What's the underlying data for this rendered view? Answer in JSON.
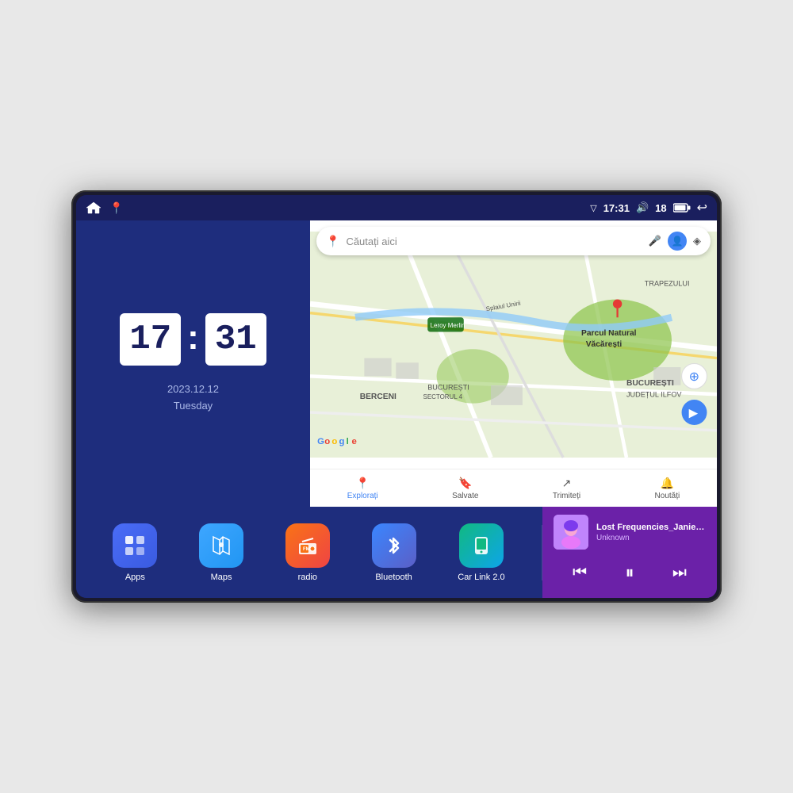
{
  "device": {
    "statusBar": {
      "time": "17:31",
      "signal": "18",
      "backLabel": "←"
    },
    "clock": {
      "hours": "17",
      "minutes": "31",
      "date": "2023.12.12",
      "day": "Tuesday"
    },
    "map": {
      "searchPlaceholder": "Căutați aici",
      "tabs": [
        {
          "label": "Explorați",
          "active": true
        },
        {
          "label": "Salvate",
          "active": false
        },
        {
          "label": "Trimiteți",
          "active": false
        },
        {
          "label": "Noutăți",
          "active": false
        }
      ],
      "markers": [
        "Parcul Natural Văcărești",
        "Leroy Merlin",
        "BUCUREȘTI",
        "JUDEȚUL ILFOV",
        "BERCENI",
        "TRAPEZULUI",
        "BUCUREȘTI SECTORUL 4"
      ]
    },
    "apps": [
      {
        "id": "apps",
        "label": "Apps",
        "icon": "⊞",
        "colorClass": "icon-apps"
      },
      {
        "id": "maps",
        "label": "Maps",
        "icon": "📍",
        "colorClass": "icon-maps"
      },
      {
        "id": "radio",
        "label": "radio",
        "icon": "📻",
        "colorClass": "icon-radio"
      },
      {
        "id": "bluetooth",
        "label": "Bluetooth",
        "icon": "⬡",
        "colorClass": "icon-bluetooth"
      },
      {
        "id": "carlink",
        "label": "Car Link 2.0",
        "icon": "📱",
        "colorClass": "icon-carlink"
      }
    ],
    "musicPlayer": {
      "title": "Lost Frequencies_Janieck Devy-...",
      "artist": "Unknown",
      "albumArtEmoji": "🎵"
    }
  }
}
